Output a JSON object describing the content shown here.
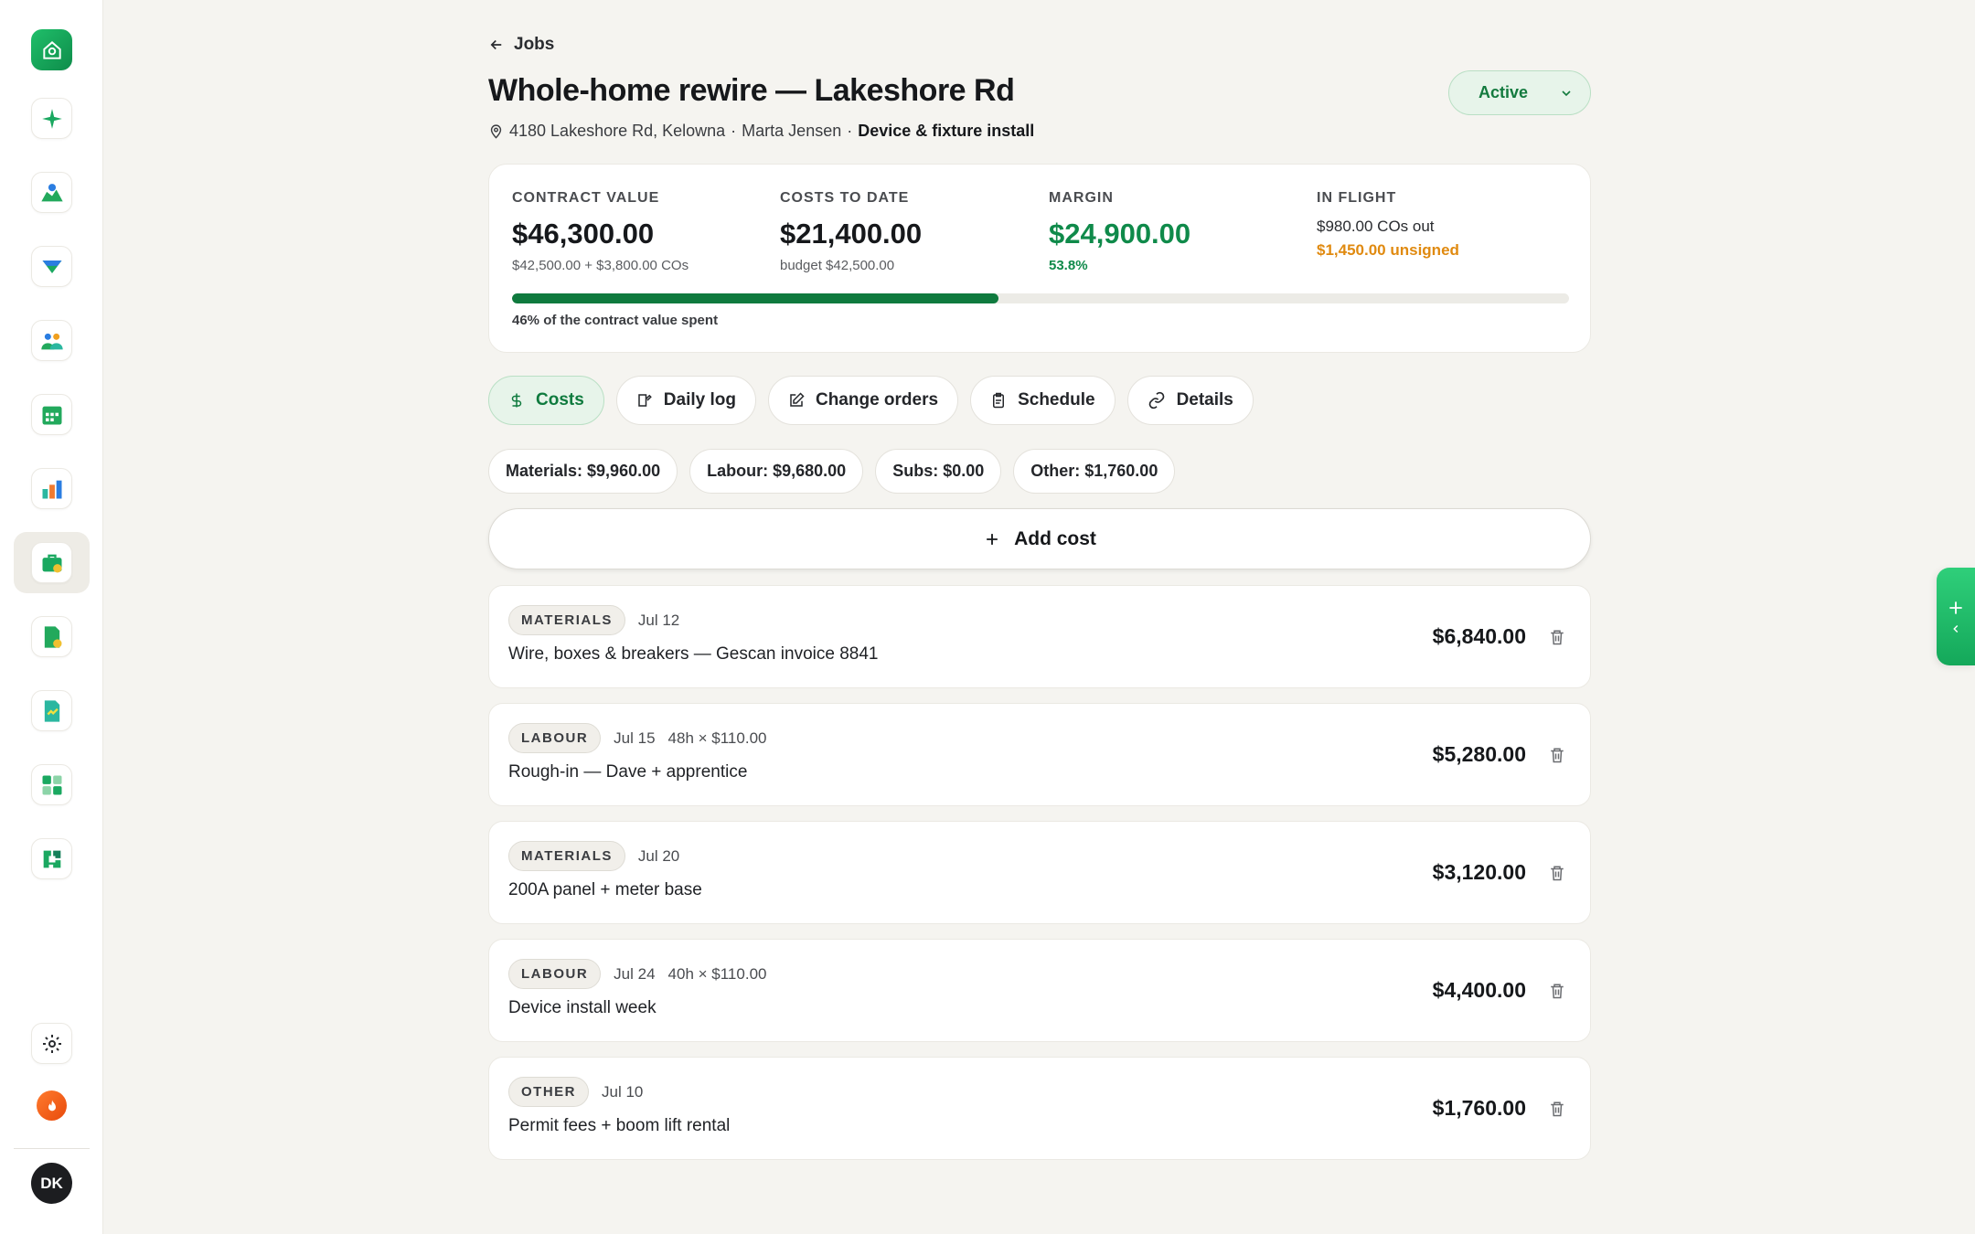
{
  "nav": {
    "user_initials": "DK"
  },
  "header": {
    "back_label": "Jobs",
    "title": "Whole-home rewire — Lakeshore Rd",
    "address": "4180 Lakeshore Rd, Kelowna",
    "client": "Marta Jensen",
    "phase": "Device & fixture install",
    "status": "Active"
  },
  "summary": {
    "contract": {
      "label": "CONTRACT VALUE",
      "value": "$46,300.00",
      "sub": "$42,500.00 + $3,800.00 COs"
    },
    "costs": {
      "label": "COSTS TO DATE",
      "value": "$21,400.00",
      "sub": "budget $42,500.00"
    },
    "margin": {
      "label": "MARGIN",
      "value": "$24,900.00",
      "sub": "53.8%"
    },
    "inflight": {
      "label": "IN FLIGHT",
      "line1": "$980.00 COs out",
      "line2": "$1,450.00 unsigned"
    },
    "progress_percent": 46,
    "progress_caption": "46% of the contract value spent"
  },
  "tabs": [
    {
      "label": "Costs",
      "icon": "dollar-icon",
      "active": true
    },
    {
      "label": "Daily log",
      "icon": "edit-log-icon",
      "active": false
    },
    {
      "label": "Change orders",
      "icon": "pen-square-icon",
      "active": false
    },
    {
      "label": "Schedule",
      "icon": "clipboard-icon",
      "active": false
    },
    {
      "label": "Details",
      "icon": "link-icon",
      "active": false
    }
  ],
  "chips": [
    "Materials: $9,960.00",
    "Labour: $9,680.00",
    "Subs: $0.00",
    "Other: $1,760.00"
  ],
  "add_cost_label": "Add cost",
  "costs": [
    {
      "category": "MATERIALS",
      "date": "Jul 12",
      "rate": "",
      "description": "Wire, boxes & breakers — Gescan invoice 8841",
      "amount": "$6,840.00"
    },
    {
      "category": "LABOUR",
      "date": "Jul 15",
      "rate": "48h × $110.00",
      "description": "Rough-in — Dave + apprentice",
      "amount": "$5,280.00"
    },
    {
      "category": "MATERIALS",
      "date": "Jul 20",
      "rate": "",
      "description": "200A panel + meter base",
      "amount": "$3,120.00"
    },
    {
      "category": "LABOUR",
      "date": "Jul 24",
      "rate": "40h × $110.00",
      "description": "Device install week",
      "amount": "$4,400.00"
    },
    {
      "category": "OTHER",
      "date": "Jul 10",
      "rate": "",
      "description": "Permit fees + boom lift rental",
      "amount": "$1,760.00"
    }
  ],
  "colors": {
    "accent_green": "#0f7a3e",
    "margin_green": "#0f8a4a",
    "warning_orange": "#e08a10"
  }
}
